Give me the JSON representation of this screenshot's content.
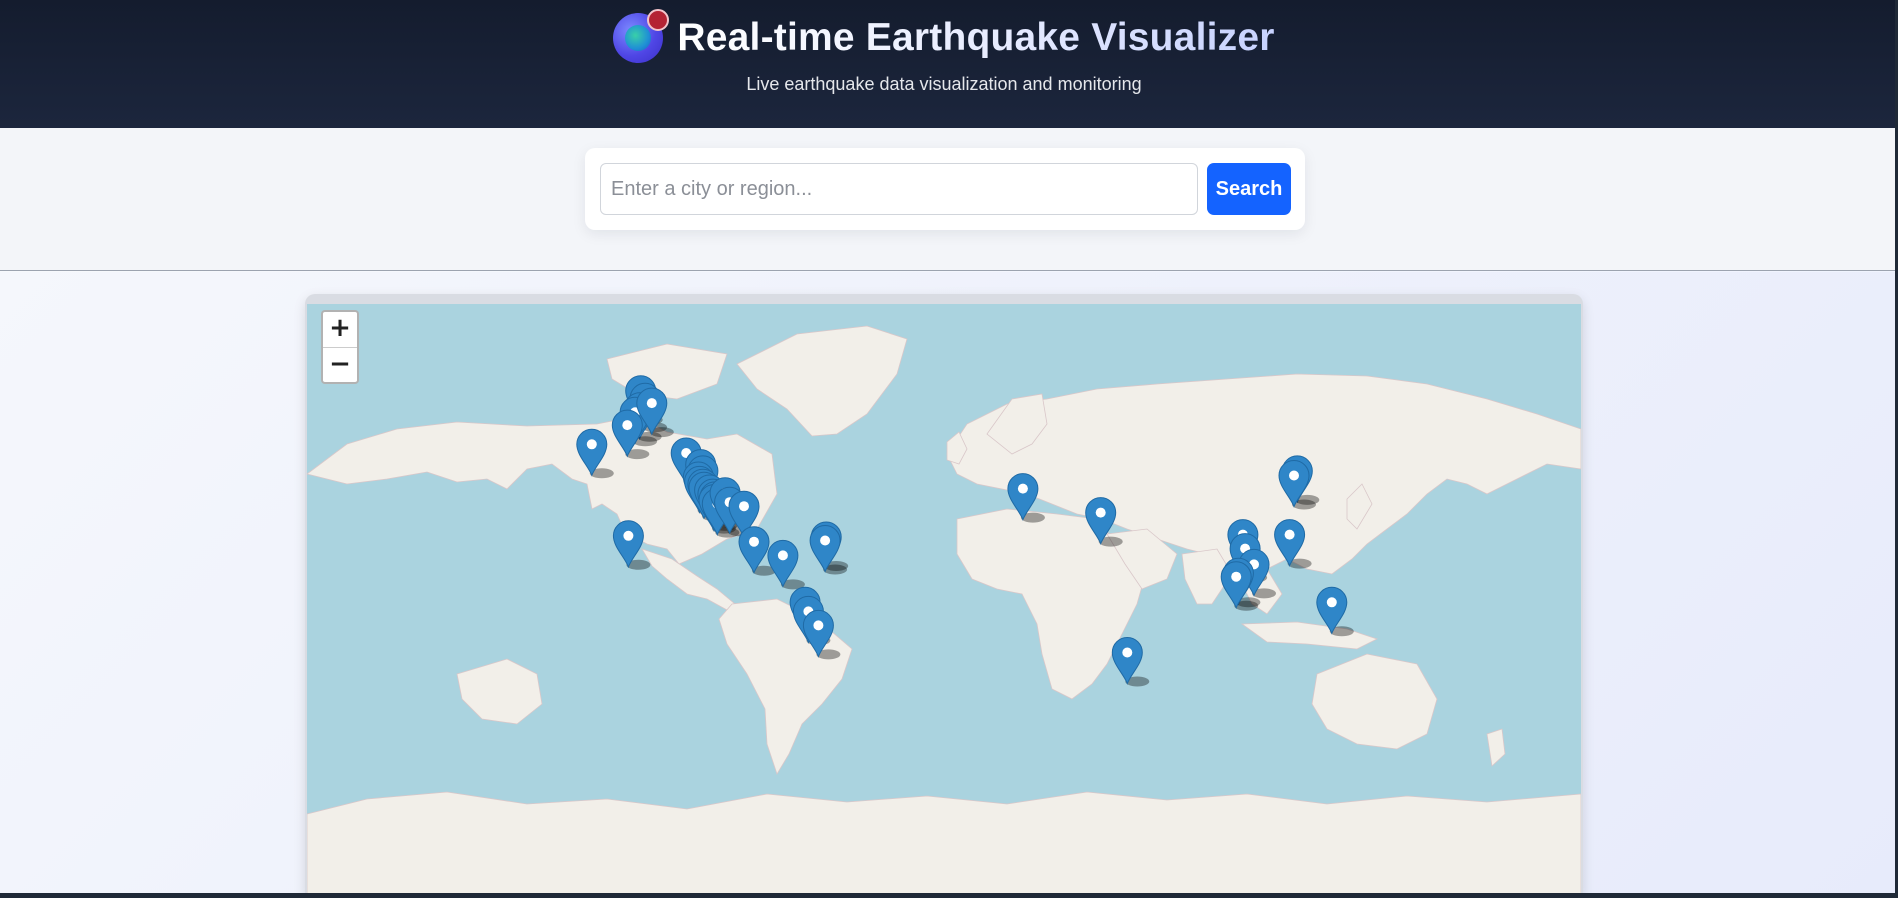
{
  "header": {
    "title": "Real-time Earthquake Visualizer",
    "subtitle": "Live earthquake data visualization and monitoring",
    "logo_icon": "globe-icon"
  },
  "search": {
    "placeholder": "Enter a city or region...",
    "value": "",
    "button_label": "Search"
  },
  "map": {
    "zoom_in_label": "+",
    "zoom_out_label": "−",
    "marker_icon": "map-marker-icon",
    "marker_color": "#2f86c8",
    "water_color": "#aad3df",
    "land_color": "#f2efe9",
    "earthquakes": [
      {
        "lat": 64.5,
        "lng": -150.0
      },
      {
        "lat": 63.0,
        "lng": -148.0
      },
      {
        "lat": 61.0,
        "lng": -150.5
      },
      {
        "lat": 60.0,
        "lng": -152.5
      },
      {
        "lat": 62.0,
        "lng": -145.0
      },
      {
        "lat": 57.0,
        "lng": -156.0
      },
      {
        "lat": 52.0,
        "lng": -172.0
      },
      {
        "lat": 49.5,
        "lng": -129.5
      },
      {
        "lat": 46.0,
        "lng": -123.0
      },
      {
        "lat": 44.0,
        "lng": -122.0
      },
      {
        "lat": 42.0,
        "lng": -124.0
      },
      {
        "lat": 40.5,
        "lng": -123.5
      },
      {
        "lat": 39.5,
        "lng": -122.0
      },
      {
        "lat": 38.5,
        "lng": -121.5
      },
      {
        "lat": 37.5,
        "lng": -119.0
      },
      {
        "lat": 36.0,
        "lng": -117.5
      },
      {
        "lat": 35.0,
        "lng": -116.5
      },
      {
        "lat": 34.0,
        "lng": -117.0
      },
      {
        "lat": 32.5,
        "lng": -115.5
      },
      {
        "lat": 36.5,
        "lng": -112.0
      },
      {
        "lat": 33.0,
        "lng": -110.0
      },
      {
        "lat": 31.5,
        "lng": -103.5
      },
      {
        "lat": 19.5,
        "lng": -155.5
      },
      {
        "lat": 17.0,
        "lng": -99.0
      },
      {
        "lat": 19.0,
        "lng": -66.5
      },
      {
        "lat": 17.5,
        "lng": -67.0
      },
      {
        "lat": 11.0,
        "lng": -86.0
      },
      {
        "lat": -10.0,
        "lng": -76.0
      },
      {
        "lat": -14.0,
        "lng": -74.5
      },
      {
        "lat": -20.0,
        "lng": -70.0
      },
      {
        "lat": 38.0,
        "lng": 22.0
      },
      {
        "lat": 29.0,
        "lng": 57.0
      },
      {
        "lat": 44.0,
        "lng": 145.5
      },
      {
        "lat": 42.5,
        "lng": 144.0
      },
      {
        "lat": 20.0,
        "lng": 121.0
      },
      {
        "lat": 14.0,
        "lng": 122.0
      },
      {
        "lat": 7.0,
        "lng": 126.0
      },
      {
        "lat": 3.0,
        "lng": 119.0
      },
      {
        "lat": 1.5,
        "lng": 118.0
      },
      {
        "lat": 20.0,
        "lng": 142.0
      },
      {
        "lat": -10.0,
        "lng": 161.0
      },
      {
        "lat": -31.0,
        "lng": 69.0
      }
    ]
  }
}
